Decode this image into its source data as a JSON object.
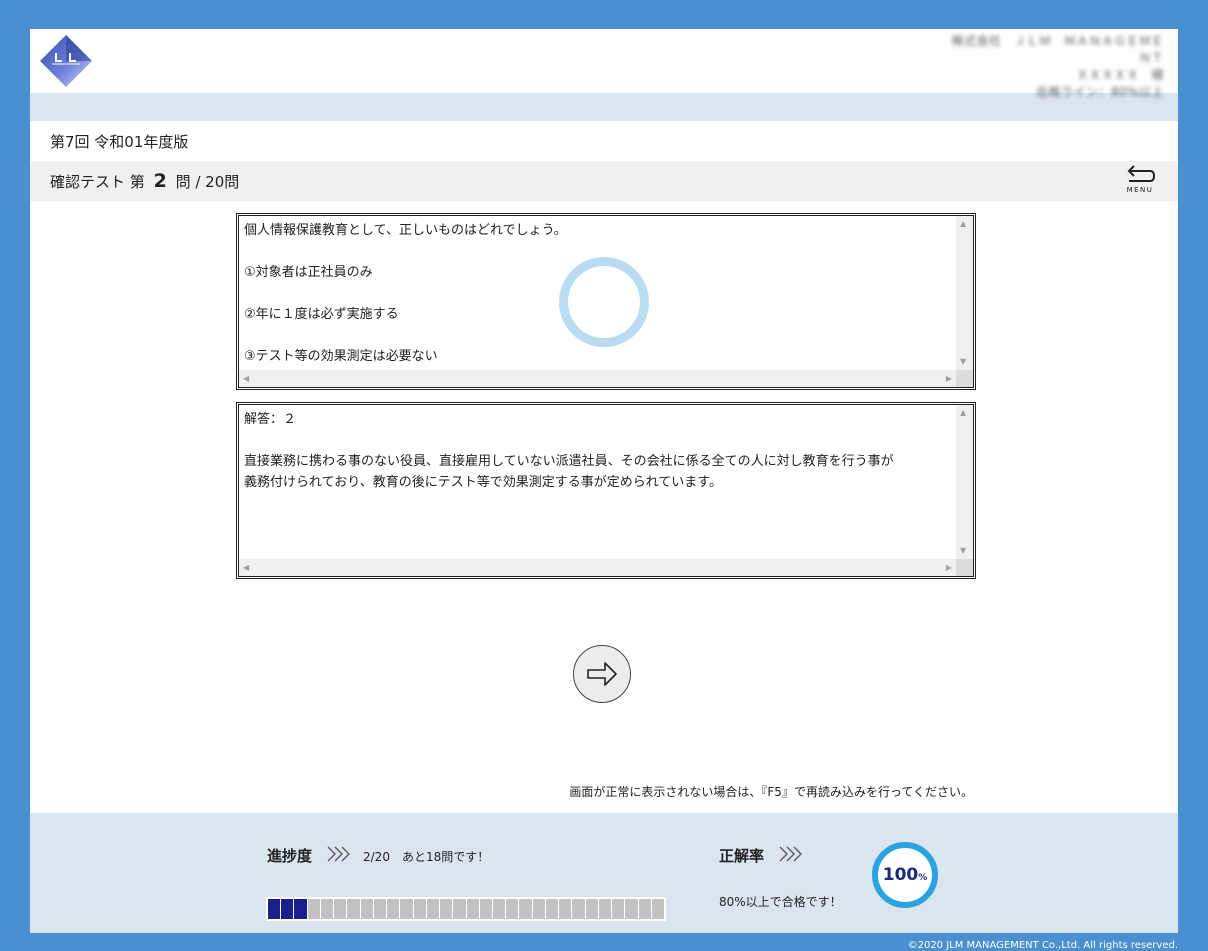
{
  "header": {
    "logo_icon": "company-logo-diamond",
    "user_info": [
      "株式会社　ＪＬＭ　ＭＡＮＡＧＥＭＥＮＴ",
      "ＸＸＸＸＸ　様",
      "合格ライン：80%以上"
    ]
  },
  "edition": "第7回 令和01年度版",
  "question_bar": {
    "prefix": "確認テスト 第",
    "current": "2",
    "suffix": "問 / 20問",
    "menu_label": "MENU"
  },
  "question": {
    "lines": [
      "個人情報保護教育として、正しいものはどれでしょう。",
      "",
      "①対象者は正社員のみ",
      "",
      "②年に１度は必ず実施する",
      "",
      "③テスト等の効果測定は必要ない"
    ]
  },
  "answer": {
    "lines": [
      "解答：２",
      "",
      "直接業務に携わる事のない役員、直接雇用していない派遣社員、その会社に係る全ての人に対し教育を行う事が",
      "義務付けられており、教育の後にテスト等で効果測定する事が定められています。"
    ]
  },
  "notice": "画面が正常に表示されない場合は、『F5』で再読み込みを行ってください。",
  "footer": {
    "progress_label": "進捗度",
    "progress_text": "2/20　あと18問です！",
    "progress_done": 3,
    "progress_total": 30,
    "rate_label": "正解率",
    "rate_value": "100",
    "rate_unit": "%",
    "pass_text": "80%以上で合格です！"
  },
  "copyright": "©2020 JLM MANAGEMENT Co.,Ltd. All rights reserved.",
  "colors": {
    "frame": "#4a8fd0",
    "progress_done": "#1b1f8c",
    "rate_ring": "#2aa3e0"
  }
}
